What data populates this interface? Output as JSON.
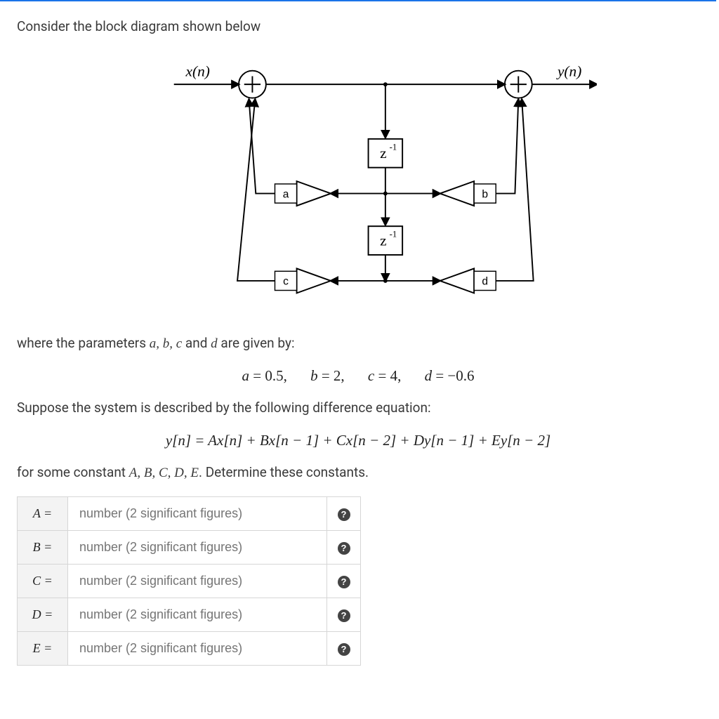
{
  "intro": "Consider the block diagram shown below",
  "diagram": {
    "input_label": "x(n)",
    "output_label": "y(n)",
    "delay1": "z",
    "delay1_sup": "-1",
    "delay2": "z",
    "delay2_sup": "-1",
    "gain_a": "a",
    "gain_b": "b",
    "gain_c": "c",
    "gain_d": "d"
  },
  "where_text_1": "where the parameters ",
  "where_params": "a, b, c",
  "where_text_2": " and ",
  "where_param_d": "d",
  "where_text_3": " are given by:",
  "params_eq": {
    "a_lhs": "a",
    "a_val": "0.5",
    "b_lhs": "b",
    "b_val": "2",
    "c_lhs": "c",
    "c_val": "4",
    "d_lhs": "d",
    "d_val": "−0.6"
  },
  "suppose_text": "Suppose the system is described by the following difference equation:",
  "diff_eq": "y[n] = Ax[n] + Bx[n − 1] + Cx[n − 2] + Dy[n − 1] + Ey[n − 2]",
  "for_text_1": "for some constant ",
  "for_consts": "A, B, C, D, E",
  "for_text_2": ". Determine these constants.",
  "placeholder": "number (2 significant figures)",
  "rows": {
    "A": "A =",
    "B": "B =",
    "C": "C =",
    "D": "D =",
    "E": "E ="
  },
  "help_glyph": "?"
}
